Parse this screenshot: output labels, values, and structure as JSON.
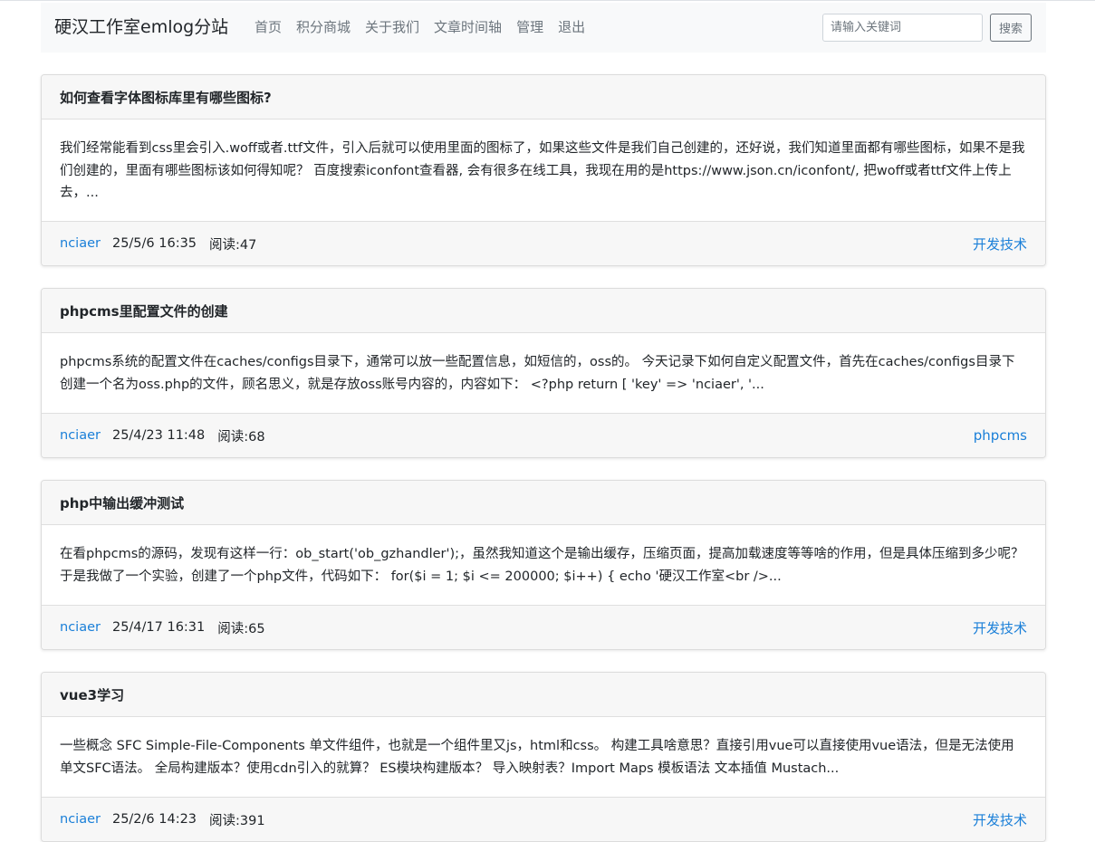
{
  "site": {
    "brand": "硬汉工作室emlog分站"
  },
  "nav": {
    "links": [
      "首页",
      "积分商城",
      "关于我们",
      "文章时间轴",
      "管理",
      "退出"
    ]
  },
  "search": {
    "placeholder": "请输入关键词",
    "value": "",
    "button_label": "搜索"
  },
  "posts": [
    {
      "title": "如何查看字体图标库里有哪些图标?",
      "excerpt": "我们经常能看到css里会引入.woff或者.ttf文件，引入后就可以使用里面的图标了，如果这些文件是我们自己创建的，还好说，我们知道里面都有哪些图标，如果不是我们创建的，里面有哪些图标该如何得知呢？ 百度搜索iconfont查看器, 会有很多在线工具，我现在用的是https://www.json.cn/iconfont/, 把woff或者ttf文件上传上去，...",
      "author": "nciaer",
      "date": "25/5/6 16:35",
      "views": "阅读:47",
      "category": "开发技术"
    },
    {
      "title": "phpcms里配置文件的创建",
      "excerpt": "phpcms系统的配置文件在caches/configs目录下，通常可以放一些配置信息，如短信的，oss的。 今天记录下如何自定义配置文件，首先在caches/configs目录下创建一个名为oss.php的文件，顾名思义，就是存放oss账号内容的，内容如下： <?php return [ 'key' => 'nciaer', '...",
      "author": "nciaer",
      "date": "25/4/23 11:48",
      "views": "阅读:68",
      "category": "phpcms"
    },
    {
      "title": "php中输出缓冲测试",
      "excerpt": "在看phpcms的源码，发现有这样一行：ob_start('ob_gzhandler');，虽然我知道这个是输出缓存，压缩页面，提高加载速度等等啥的作用，但是具体压缩到多少呢？ 于是我做了一个实验，创建了一个php文件，代码如下： for($i = 1; $i <= 200000; $i++) { echo '硬汉工作室<br />...",
      "author": "nciaer",
      "date": "25/4/17 16:31",
      "views": "阅读:65",
      "category": "开发技术"
    },
    {
      "title": "vue3学习",
      "excerpt": "一些概念 SFC Simple-File-Components 单文件组件，也就是一个组件里又js，html和css。 构建工具啥意思？直接引用vue可以直接使用vue语法，但是无法使用单文SFC语法。 全局构建版本？使用cdn引入的就算？ ES模块构建版本？ 导入映射表？Import Maps 模板语法 文本插值 Mustach...",
      "author": "nciaer",
      "date": "25/2/6 14:23",
      "views": "阅读:391",
      "category": "开发技术"
    }
  ]
}
